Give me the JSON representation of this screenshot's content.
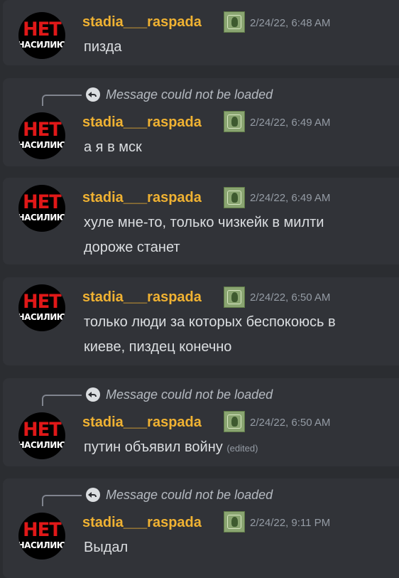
{
  "messages": [
    {
      "username": "stadia___raspada",
      "timestamp": "2/24/22, 6:48 AM",
      "lines": [
        "пизда"
      ]
    },
    {
      "reply": "Message could not be loaded",
      "username": "stadia___raspada",
      "timestamp": "2/24/22, 6:49 AM",
      "lines": [
        "а я в мск"
      ]
    },
    {
      "username": "stadia___raspada",
      "timestamp": "2/24/22, 6:49 AM",
      "lines": [
        "хуле мне-то, только чизкейк в милти",
        "дороже станет"
      ]
    },
    {
      "username": "stadia___raspada",
      "timestamp": "2/24/22, 6:50 AM",
      "lines": [
        "только люди за которых беспокоюсь в",
        "киеве, пиздец конечно"
      ]
    },
    {
      "reply": "Message could not be loaded",
      "username": "stadia___raspada",
      "timestamp": "2/24/22, 6:50 AM",
      "lines": [
        "путин объявил войну"
      ],
      "edited": "(edited)"
    },
    {
      "reply": "Message could not be loaded",
      "username": "stadia___raspada",
      "timestamp": "2/24/22, 9:11 PM",
      "lines": [
        "Выдал"
      ]
    }
  ],
  "avatar": {
    "line1": "НЕТ",
    "line2": "НАСИЛИЮ"
  },
  "colors": {
    "background": "#2b2d31",
    "card": "#313338",
    "username": "#f0b232",
    "text": "#dbdee1",
    "muted": "#949ba4",
    "avatar_red": "#e01818"
  },
  "icons": {
    "reply": "reply-arrow-icon",
    "badge": "role-badge-icon"
  }
}
